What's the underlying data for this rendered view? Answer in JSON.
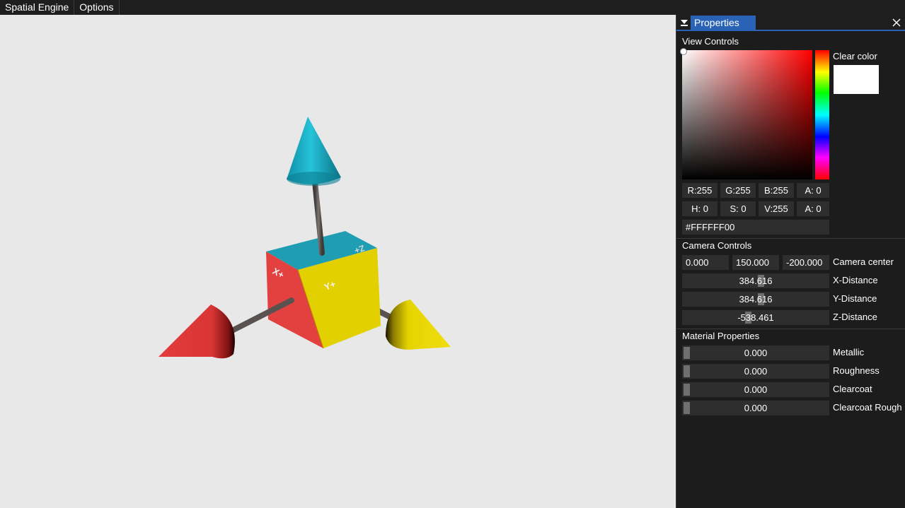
{
  "menubar": {
    "items": [
      {
        "label": "Spatial Engine"
      },
      {
        "label": "Options"
      }
    ]
  },
  "viewport": {
    "cube_faces": {
      "x_label": "X+",
      "y_label": "Y+",
      "z_label": "Z+"
    },
    "colors": {
      "x_axis": "#e03a3a",
      "y_axis": "#e7d400",
      "z_axis": "#1bb5cc",
      "background": "#e8e8e8"
    }
  },
  "panel": {
    "tab_title": "Properties",
    "collapse_icon": "triangle-down-icon",
    "close_icon": "close-icon",
    "view_controls": {
      "title": "View Controls",
      "clear_color_label": "Clear color",
      "rgba": [
        "R:255",
        "G:255",
        "B:255",
        "A:  0"
      ],
      "hsva": [
        "H:  0",
        "S:  0",
        "V:255",
        "A:  0"
      ],
      "hex": "#FFFFFF00"
    },
    "camera_controls": {
      "title": "Camera Controls",
      "center": [
        "0.000",
        "150.000",
        "-200.000"
      ],
      "center_label": "Camera center",
      "x_distance": "384.616",
      "x_distance_label": "X-Distance",
      "y_distance": "384.616",
      "y_distance_label": "Y-Distance",
      "z_distance": "-538.461",
      "z_distance_label": "Z-Distance"
    },
    "material_properties": {
      "title": "Material Properties",
      "sliders": [
        {
          "value": "0.000",
          "label": "Metallic"
        },
        {
          "value": "0.000",
          "label": "Roughness"
        },
        {
          "value": "0.000",
          "label": "Clearcoat"
        },
        {
          "value": "0.000",
          "label": "Clearcoat Rough"
        }
      ]
    }
  }
}
